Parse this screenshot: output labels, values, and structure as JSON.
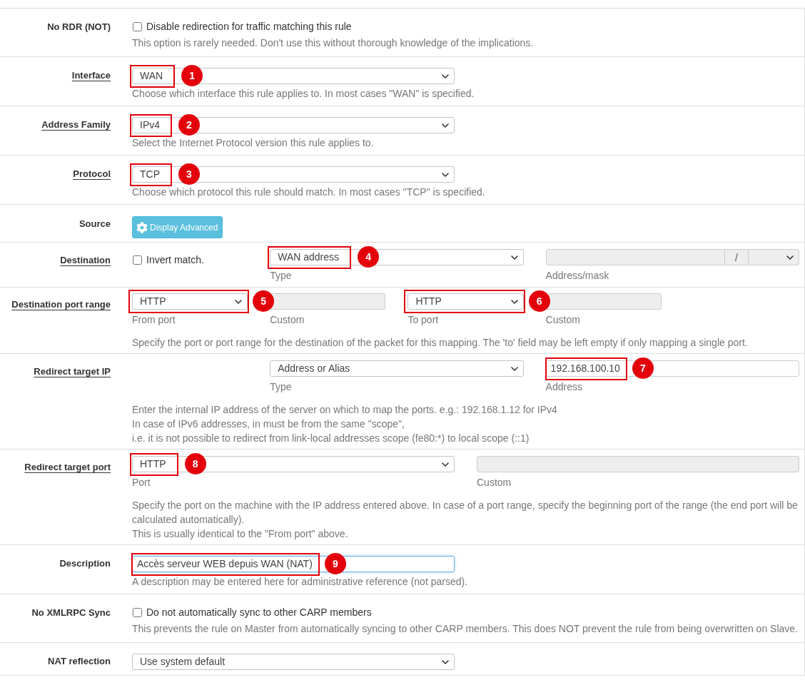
{
  "rows": [
    {
      "kind": "checkbox",
      "label": "No RDR (NOT)",
      "link": false,
      "fields": [
        {
          "kind": "checkbox",
          "label": "Disable redirection for traffic matching this rule",
          "checked": false
        }
      ],
      "help": [
        "This option is rarely needed. Don't use this without thorough knowledge of the implications."
      ]
    },
    {
      "kind": "select",
      "label": "Interface",
      "link": true,
      "fields": [
        {
          "kind": "select",
          "value": "WAN",
          "callout": {
            "number": "1",
            "whole_field": false
          }
        }
      ],
      "help": [
        "Choose which interface this rule applies to. In most cases \"WAN\" is specified."
      ]
    },
    {
      "kind": "select",
      "label": "Address Family",
      "link": true,
      "fields": [
        {
          "kind": "select",
          "value": "IPv4",
          "callout": {
            "number": "2",
            "whole_field": false
          }
        }
      ],
      "help": [
        "Select the Internet Protocol version this rule applies to."
      ]
    },
    {
      "kind": "select",
      "label": "Protocol",
      "link": true,
      "fields": [
        {
          "kind": "select",
          "value": "TCP",
          "callout": {
            "number": "3",
            "whole_field": false
          }
        }
      ],
      "help": [
        "Choose which protocol this rule should match. In most cases \"TCP\" is specified."
      ]
    },
    {
      "kind": "button",
      "label": "Source",
      "link": false,
      "fields": [
        {
          "kind": "button",
          "label": "Display Advanced"
        }
      ]
    },
    {
      "kind": "destination",
      "label": "Destination",
      "link": true,
      "fields": [
        {
          "kind": "checkbox",
          "label": "Invert match.",
          "checked": false
        },
        {
          "kind": "select",
          "value": "WAN address",
          "caption": "Type",
          "callout": {
            "number": "4",
            "whole_field": false
          }
        },
        {
          "kind": "address_mask",
          "separator": "/",
          "caption": "Address/mask",
          "disabled": true
        }
      ]
    },
    {
      "kind": "port_range",
      "label": "Destination port range",
      "link": true,
      "fields": [
        {
          "kind": "select",
          "value": "HTTP",
          "caption": "From port",
          "callout": {
            "number": "5",
            "whole_field": true
          }
        },
        {
          "kind": "input",
          "caption": "Custom",
          "disabled": true,
          "focused": false
        },
        {
          "kind": "select",
          "value": "HTTP",
          "caption": "To port",
          "callout": {
            "number": "6",
            "whole_field": true
          }
        },
        {
          "kind": "input",
          "caption": "Custom",
          "disabled": true,
          "focused": false
        }
      ],
      "help": [
        "Specify the port or port range for the destination of the packet for this mapping. The 'to' field may be left empty if only mapping a single port."
      ]
    },
    {
      "kind": "target_ip",
      "label": "Redirect target IP",
      "link": true,
      "fields": [
        {
          "kind": "select",
          "value": "Address or Alias",
          "caption": "Type"
        },
        {
          "kind": "input",
          "value": "192.168.100.10",
          "caption": "Address",
          "disabled": false,
          "focused": false,
          "callout": {
            "number": "7",
            "whole_field": false
          }
        }
      ],
      "help": [
        "Enter the internal IP address of the server on which to map the ports. e.g.: 192.168.1.12 for IPv4",
        "In case of IPv6 addresses, in must be from the same \"scope\",",
        "i.e. it is not possible to redirect from link-local addresses scope (fe80:*) to local scope (::1)"
      ]
    },
    {
      "kind": "target_port",
      "label": "Redirect target port",
      "link": true,
      "fields": [
        {
          "kind": "select",
          "value": "HTTP",
          "caption": "Port",
          "callout": {
            "number": "8",
            "whole_field": false
          }
        },
        {
          "kind": "input",
          "caption": "Custom",
          "disabled": true,
          "focused": false
        }
      ],
      "help": [
        "Specify the port on the machine with the IP address entered above. In case of a port range, specify the beginning port of the range (the end port will be calculated automatically).",
        "This is usually identical to the \"From port\" above."
      ]
    },
    {
      "kind": "text",
      "label": "Description",
      "link": false,
      "fields": [
        {
          "kind": "input",
          "value": "Accès serveur WEB depuis WAN (NAT)",
          "disabled": false,
          "focused": true,
          "callout": {
            "number": "9",
            "whole_field": false
          }
        }
      ],
      "help": [
        "A description may be entered here for administrative reference (not parsed)."
      ]
    },
    {
      "kind": "checkbox",
      "label": "No XMLRPC Sync",
      "link": false,
      "fields": [
        {
          "kind": "checkbox",
          "label": "Do not automatically sync to other CARP members",
          "checked": false
        }
      ],
      "help": [
        "This prevents the rule on Master from automatically syncing to other CARP members. This does NOT prevent the rule from being overwritten on Slave."
      ]
    },
    {
      "kind": "select",
      "label": "NAT reflection",
      "link": false,
      "fields": [
        {
          "kind": "select",
          "value": "Use system default"
        }
      ]
    }
  ]
}
